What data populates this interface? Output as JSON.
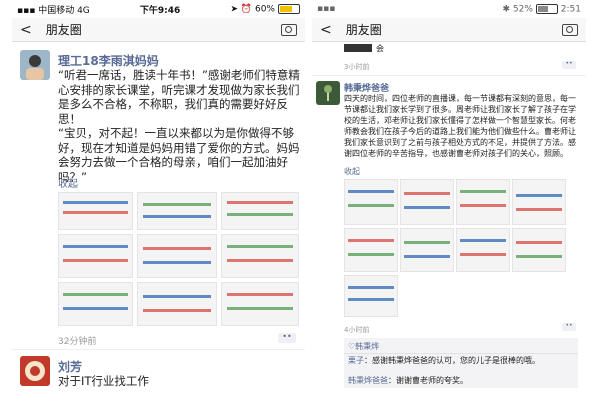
{
  "left": {
    "status": {
      "carrier": "中国移动",
      "network": "4G",
      "time": "下午9:46",
      "battery": "60%"
    },
    "nav": {
      "back": "<",
      "title": "朋友圈"
    },
    "post": {
      "author": "理工18李雨淇妈妈",
      "text": "“听君一席话，胜读十年书！”感谢老师们特意精心安排的家长课堂，听完课才发现做为家长我们是多么不合格，不称职，我们真的需要好好反思！\n“宝贝，对不起！一直以来都以为是你做得不够好，现在才知道是妈妈用错了爱你的方式。妈妈会努力去做一个合格的母亲，咱们一起加油好吗？”",
      "collapse": "收起",
      "time": "32分钟前"
    },
    "next_post": {
      "author": "刘芳",
      "text": "对于IT行业找工作"
    }
  },
  "right": {
    "status": {
      "battery": "52%",
      "time": "2:51"
    },
    "nav": {
      "back": "<",
      "title": "朋友圈"
    },
    "top_snippet": "会",
    "top_time": "3小时前",
    "post": {
      "author": "韩秉烨爸爸",
      "text": "四天的时间，四位老师的直播课，每一节课都有深刻的意思，每一节课都让我们家长学到了很多。周老师让我们家长了解了孩子在学校的生活，邓老师让我们家长懂得了怎样做一个智慧型家长。何老师教会我们在孩子今后的道路上我们能为他们做些什么。曹老师让我们家长意识到了之前与孩子相处方式的不足，并提供了方法。感谢四位老师的辛苦指导，也感谢曹老师对孩子们的关心，照顾。",
      "collapse": "收起",
      "time": "4小时前"
    },
    "likes": "韩秉烨",
    "comments": [
      {
        "who": "栗子",
        "text": "：感谢韩秉烨爸爸的认可，您的儿子是很棒的哦。"
      },
      {
        "who": "韩秉烨爸爸",
        "text": "：谢谢曹老师的夸奖。"
      }
    ]
  }
}
